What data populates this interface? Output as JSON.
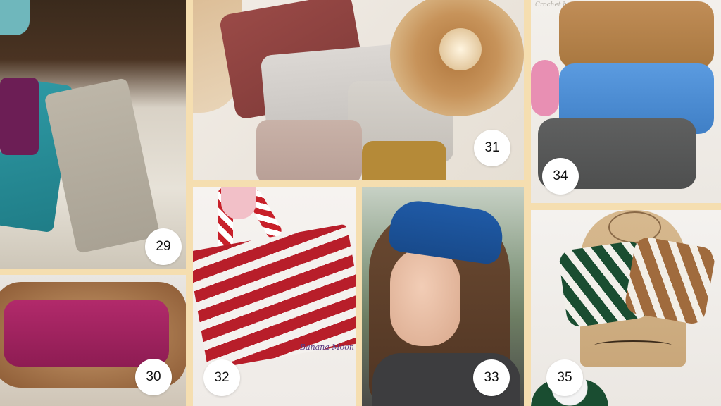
{
  "tiles": [
    {
      "number": "29"
    },
    {
      "number": "30"
    },
    {
      "number": "31"
    },
    {
      "number": "32",
      "watermark": "Banana Moon"
    },
    {
      "number": "33"
    },
    {
      "number": "34",
      "watermark": "Crochet by Carolyn"
    },
    {
      "number": "35"
    }
  ]
}
